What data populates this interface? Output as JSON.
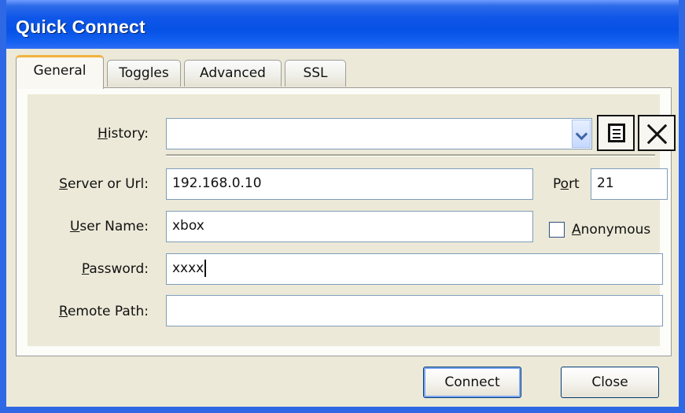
{
  "window": {
    "title": "Quick Connect"
  },
  "tabs": [
    {
      "label": "General",
      "selected": true
    },
    {
      "label": "Toggles",
      "selected": false
    },
    {
      "label": "Advanced",
      "selected": false
    },
    {
      "label": "SSL",
      "selected": false
    }
  ],
  "form": {
    "history": {
      "label_mnemonic": "H",
      "label_rest": "istory:",
      "value": "",
      "chevron_icon": "chevron-down-icon"
    },
    "server": {
      "label_mnemonic": "S",
      "label_rest": "erver or Url:",
      "value": "192.168.0.10"
    },
    "port": {
      "label_before": "P",
      "label_mnemonic": "o",
      "label_after": "rt",
      "value": "21"
    },
    "username": {
      "label_mnemonic": "U",
      "label_rest": "ser Name:",
      "value": "xbox"
    },
    "anonymous": {
      "label_mnemonic": "A",
      "label_rest": "nonymous",
      "checked": false
    },
    "password": {
      "label_mnemonic": "P",
      "label_rest": "assword:",
      "value": "xxxx"
    },
    "remote_path": {
      "label_mnemonic": "R",
      "label_rest": "emote Path:",
      "value": ""
    }
  },
  "toolbar": {
    "history_icon": "list-icon",
    "clear_icon": "close-icon"
  },
  "buttons": {
    "connect": "Connect",
    "close": "Close"
  },
  "colors": {
    "titlebar": "#0652e6",
    "dialog_background": "#ece9d8",
    "active_tab_accent": "#f3b33d",
    "field_border": "#7f9db9"
  }
}
